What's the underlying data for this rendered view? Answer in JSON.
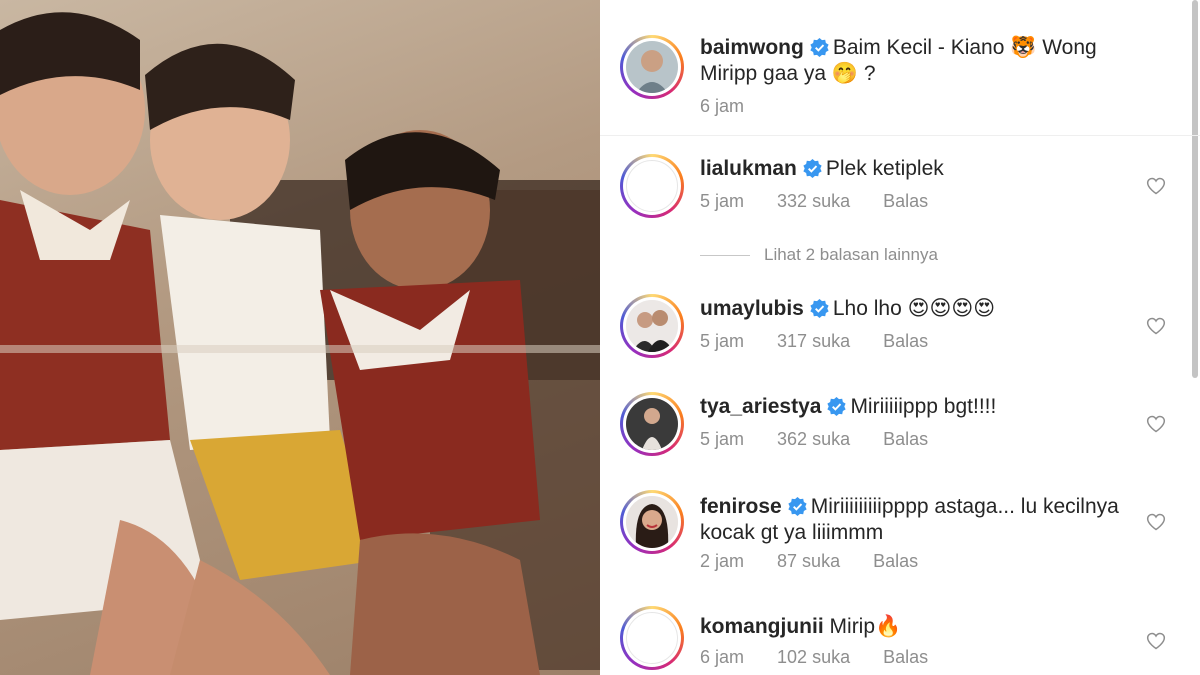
{
  "post": {
    "author": "baimwong",
    "caption": "Baim Kecil - Kiano 🐯 Wong Miripp gaa ya 🤭 ?",
    "time": "6 jam"
  },
  "more_replies": "Lihat 2 balasan lainnya",
  "comments": [
    {
      "user": "lialukman",
      "text": "Plek ketiplek",
      "time": "5 jam",
      "likes": "332 suka",
      "reply": "Balas"
    },
    {
      "user": "umaylubis",
      "text": "Lho lho 😍😍😍😍",
      "time": "5 jam",
      "likes": "317 suka",
      "reply": "Balas"
    },
    {
      "user": "tya_ariestya",
      "text": "Miriiiiippp bgt!!!!",
      "time": "5 jam",
      "likes": "362 suka",
      "reply": "Balas"
    },
    {
      "user": "fenirose",
      "text": "Miriiiiiiiiipppp astaga... lu kecilnya kocak gt ya liiimmm",
      "time": "2 jam",
      "likes": "87 suka",
      "reply": "Balas"
    },
    {
      "user": "komangjunii",
      "text": "Mirip🔥",
      "time": "6 jam",
      "likes": "102 suka",
      "reply": "Balas"
    }
  ],
  "icons": {
    "verified": "verified-badge-icon",
    "like": "heart-icon"
  },
  "colors": {
    "verified": "#3897f0",
    "username": "#262626",
    "meta": "#8e8e8e"
  }
}
